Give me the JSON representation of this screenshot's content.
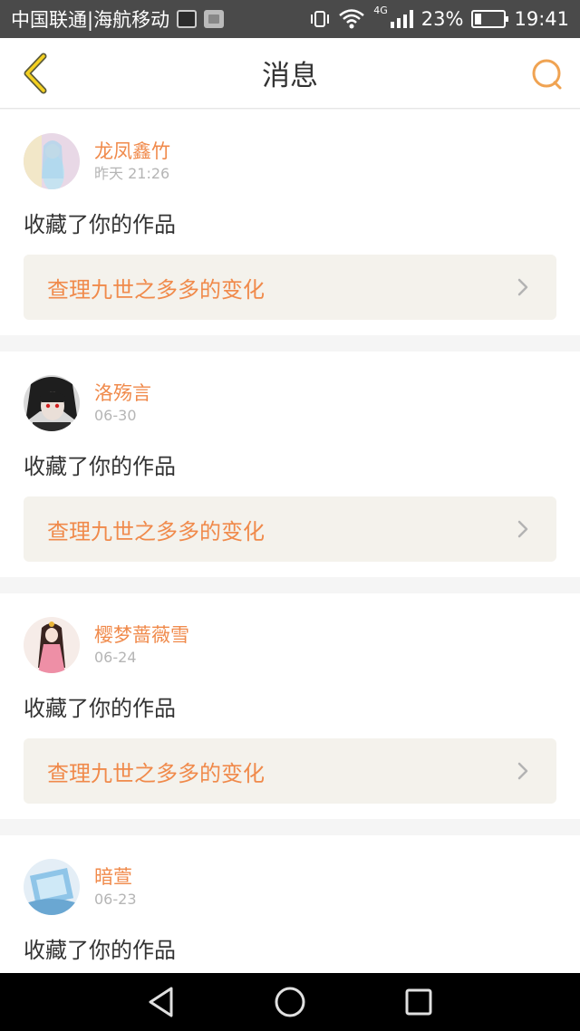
{
  "status_bar": {
    "carrier": "中国联通|海航移动",
    "network": "4G",
    "battery_level": "23%",
    "battery_fraction": 0.23,
    "time": "19:41"
  },
  "header": {
    "title": "消息",
    "back_icon": "chevron-left-icon",
    "search_icon": "search-icon",
    "accent_color": "#f0a352"
  },
  "messages": [
    {
      "user": "龙凤鑫竹",
      "time": "昨天 21:26",
      "action": "收藏了你的作品",
      "work_title": "查理九世之多多的变化"
    },
    {
      "user": "洛殇言",
      "time": "06-30",
      "action": "收藏了你的作品",
      "work_title": "查理九世之多多的变化"
    },
    {
      "user": "樱梦蔷薇雪",
      "time": "06-24",
      "action": "收藏了你的作品",
      "work_title": "查理九世之多多的变化"
    },
    {
      "user": "暗萱",
      "time": "06-23",
      "action": "收藏了你的作品",
      "work_title": ""
    }
  ],
  "colors": {
    "username": "#f08a4b",
    "work_title": "#f08a4b",
    "work_bg": "#f4f2ec"
  }
}
